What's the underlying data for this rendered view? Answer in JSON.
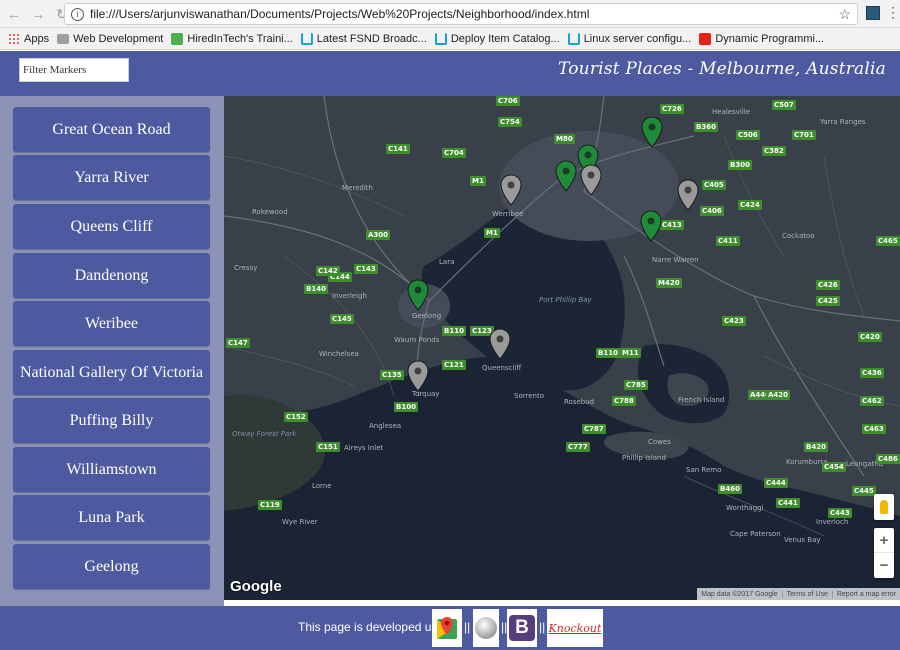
{
  "browser": {
    "url": "file:///Users/arjunviswanathan/Documents/Projects/Web%20Projects/Neighborhood/index.html",
    "bookmarks": [
      {
        "label": "Apps",
        "icon": "apps-grid-icon"
      },
      {
        "label": "Web Development",
        "icon": "folder-icon"
      },
      {
        "label": "HiredInTech's Traini...",
        "icon": "hiredintech-icon"
      },
      {
        "label": "Latest FSND Broadc...",
        "icon": "udacity-icon"
      },
      {
        "label": "Deploy Item Catalog...",
        "icon": "udacity-icon"
      },
      {
        "label": "Linux server configu...",
        "icon": "udacity-icon"
      },
      {
        "label": "Dynamic Programmi...",
        "icon": "youtube-icon"
      }
    ]
  },
  "header": {
    "filter_placeholder": "Filter Markers",
    "title": "Tourist Places - Melbourne, Australia"
  },
  "sidebar": {
    "places": [
      "Great Ocean Road",
      "Yarra River",
      "Queens Cliff",
      "Dandenong",
      "Weribee",
      "National Gallery Of Victoria",
      "Puffing Billy",
      "Williamstown",
      "Luna Park",
      "Geelong"
    ]
  },
  "map": {
    "logo": "Google",
    "attribution": [
      "Map data ©2017 Google",
      "Terms of Use",
      "Report a map error"
    ],
    "zoom_in": "+",
    "zoom_out": "−",
    "places": [
      {
        "label": "Meredith"
      },
      {
        "label": "Rokewood"
      },
      {
        "label": "Cressy"
      },
      {
        "label": "Inverleigh"
      },
      {
        "label": "Lara"
      },
      {
        "label": "Geelong"
      },
      {
        "label": "Waurn Ponds"
      },
      {
        "label": "Winchelsea"
      },
      {
        "label": "Torquay"
      },
      {
        "label": "Anglesea"
      },
      {
        "label": "Aireys Inlet"
      },
      {
        "label": "Otway Forest Park"
      },
      {
        "label": "Wye River"
      },
      {
        "label": "Lorne"
      },
      {
        "label": "Werribee"
      },
      {
        "label": "Queenscliff"
      },
      {
        "label": "Sorrento"
      },
      {
        "label": "Rosebud"
      },
      {
        "label": "Port Phillip Bay"
      },
      {
        "label": "French Island"
      },
      {
        "label": "Cowes"
      },
      {
        "label": "Phillip Island"
      },
      {
        "label": "San Remo"
      },
      {
        "label": "Wonthaggi"
      },
      {
        "label": "Cape Paterson"
      },
      {
        "label": "Venus Bay"
      },
      {
        "label": "Inverloch"
      },
      {
        "label": "Narre Warren"
      },
      {
        "label": "Healesville"
      },
      {
        "label": "Yarra Ranges"
      },
      {
        "label": "Cockatoo"
      },
      {
        "label": "Korumburra"
      },
      {
        "label": "Leongatha"
      }
    ],
    "roads": [
      "C706",
      "C754",
      "C726",
      "C507",
      "B360",
      "C506",
      "C701",
      "C141",
      "C704",
      "M80",
      "C382",
      "B300",
      "M1",
      "C405",
      "C406",
      "C424",
      "C411",
      "M420",
      "C413",
      "C143",
      "C144",
      "C142",
      "B140",
      "C145",
      "B110",
      "C123",
      "C121",
      "C135",
      "B100",
      "C119",
      "C151",
      "C152",
      "C147",
      "A300",
      "M1",
      "C423",
      "C426",
      "C425",
      "C420",
      "B110",
      "M11",
      "C785",
      "C788",
      "C787",
      "C777",
      "A440",
      "A420",
      "C444",
      "C454",
      "B460",
      "C441",
      "C443",
      "C445",
      "C436",
      "C462",
      "C463",
      "C465",
      "C486",
      "B420"
    ],
    "markers": [
      {
        "name": "Great Ocean Road",
        "color": "grey"
      },
      {
        "name": "Yarra River",
        "color": "green"
      },
      {
        "name": "Queens Cliff",
        "color": "grey"
      },
      {
        "name": "Dandenong",
        "color": "grey"
      },
      {
        "name": "Weribee",
        "color": "grey"
      },
      {
        "name": "National Gallery Of Victoria",
        "color": "green"
      },
      {
        "name": "Puffing Billy",
        "color": "green"
      },
      {
        "name": "Williamstown",
        "color": "green"
      },
      {
        "name": "Luna Park",
        "color": "grey"
      },
      {
        "name": "Geelong",
        "color": "green"
      }
    ]
  },
  "footer": {
    "text": "This page is developed using",
    "separator": "||",
    "knockout_label": "Knockout",
    "bootstrap_label": "B"
  },
  "colors": {
    "header_bg": "#4d5aa0",
    "sidebar_bg": "#8d93b7",
    "map_land": "#39404a",
    "map_water": "#1c2535",
    "marker_green": "#1f8a3a",
    "marker_grey": "#9a9a9a"
  }
}
